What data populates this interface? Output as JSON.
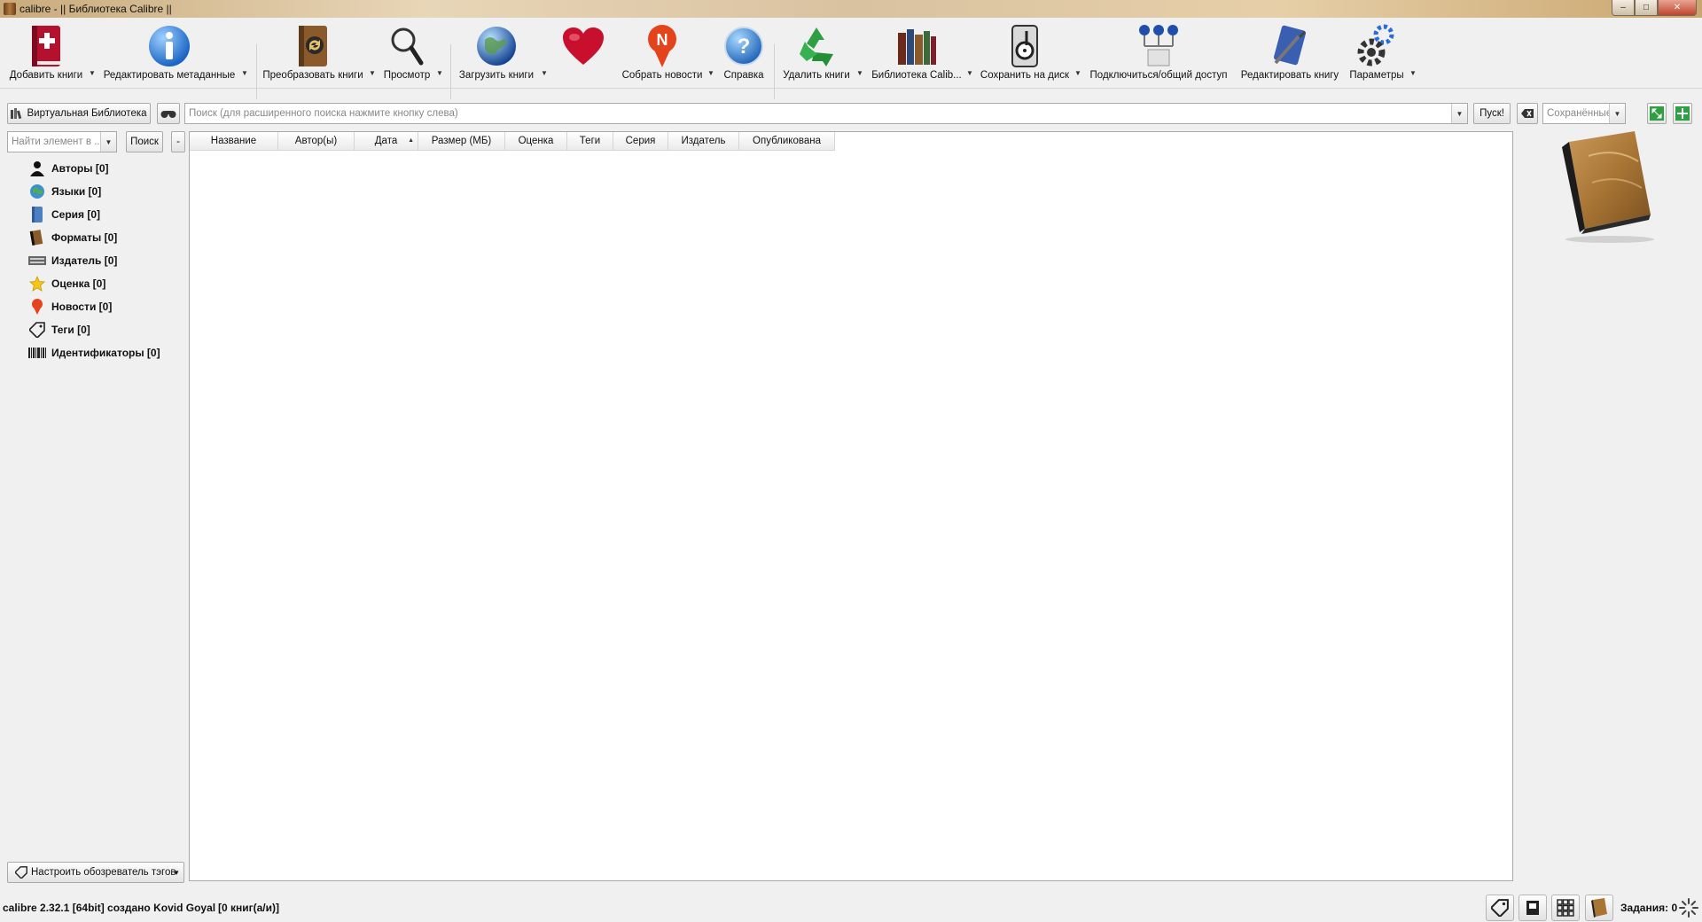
{
  "window": {
    "title": "calibre - || Библиотека Calibre ||",
    "controls": {
      "minimize": "‒",
      "maximize": "□",
      "close": "✕"
    }
  },
  "toolbar": {
    "items": [
      {
        "label": "Добавить книги",
        "icon": "add-book-icon"
      },
      {
        "label": "Редактировать метаданные",
        "icon": "info-icon"
      },
      {
        "label": "Преобразовать книги",
        "icon": "convert-icon"
      },
      {
        "label": "Просмотр",
        "icon": "magnifier-icon"
      },
      {
        "label": "Загрузить книги",
        "icon": "globe-icon"
      },
      {
        "label": "",
        "icon": "heart-icon"
      },
      {
        "label": "Собрать новости",
        "icon": "news-icon"
      },
      {
        "label": "Справка",
        "icon": "help-icon"
      },
      {
        "label": "Удалить книги",
        "icon": "recycle-icon"
      },
      {
        "label": "Библиотека Calib...",
        "icon": "library-icon"
      },
      {
        "label": "Сохранить на диск",
        "icon": "save-disk-icon"
      },
      {
        "label": "Подключиться/общий доступ",
        "icon": "connect-share-icon"
      },
      {
        "label": "Редактировать книгу",
        "icon": "edit-book-icon"
      },
      {
        "label": "Параметры",
        "icon": "gear-icon"
      }
    ]
  },
  "search": {
    "virtual_library_label": "Виртуальная Библиотека",
    "placeholder": "Поиск (для расширенного поиска нажмите кнопку слева)",
    "go_label": "Пуск!",
    "saved_placeholder": "Сохранённые ..."
  },
  "tag_browser": {
    "find_placeholder": "Найти элемент в ...",
    "find_button": "Поиск",
    "collapse_button": "-",
    "items": [
      {
        "label": "Авторы [0]",
        "icon": "person-icon"
      },
      {
        "label": "Языки [0]",
        "icon": "languages-icon"
      },
      {
        "label": "Серия [0]",
        "icon": "series-icon"
      },
      {
        "label": "Форматы [0]",
        "icon": "formats-icon"
      },
      {
        "label": "Издатель [0]",
        "icon": "publisher-icon"
      },
      {
        "label": "Оценка [0]",
        "icon": "star-icon"
      },
      {
        "label": "Новости [0]",
        "icon": "news-pin-icon"
      },
      {
        "label": "Теги [0]",
        "icon": "tag-icon"
      },
      {
        "label": "Идентификаторы [0]",
        "icon": "barcode-icon"
      }
    ],
    "configure_label": "Настроить обозреватель тэгов"
  },
  "booklist": {
    "columns": [
      "Название",
      "Автор(ы)",
      "Дата",
      "Размер (МБ)",
      "Оценка",
      "Теги",
      "Серия",
      "Издатель",
      "Опубликована"
    ],
    "sort_indicator": "▲"
  },
  "status": {
    "version": "calibre 2.32.1 [64bit] создано Kovid Goyal",
    "count": "[0 книг(а/и)]",
    "jobs": "Задания: 0"
  },
  "colors": {
    "window_bg": "#f0f0f0",
    "list_bg": "#ffffff",
    "accent_red": "#c8102e",
    "accent_green": "#2ea043"
  }
}
